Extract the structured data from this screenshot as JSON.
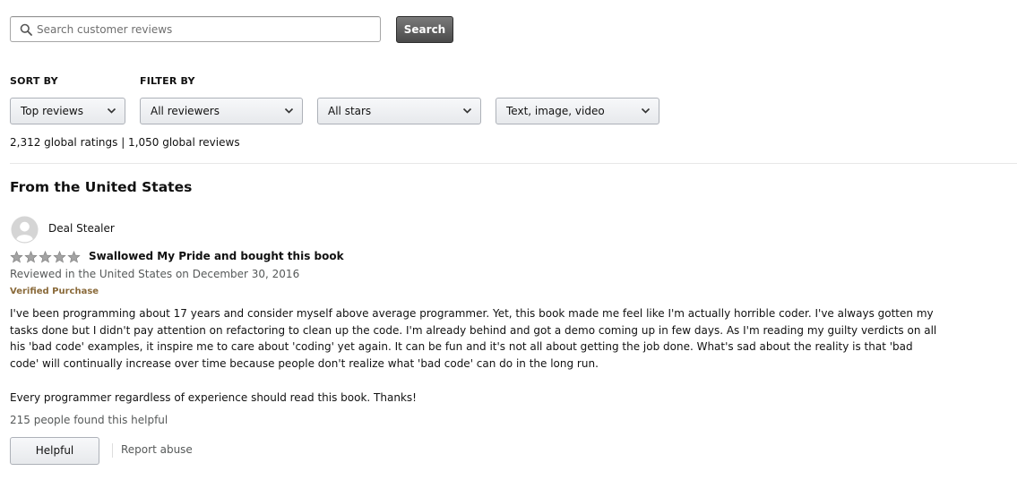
{
  "search": {
    "placeholder": "Search customer reviews",
    "button_label": "Search"
  },
  "sort": {
    "label": "SORT BY",
    "selected": "Top reviews"
  },
  "filter": {
    "label": "FILTER BY",
    "reviewers_selected": "All reviewers",
    "stars_selected": "All stars",
    "format_selected": "Text, image, video"
  },
  "summary": {
    "ratings_text": "2,312 global ratings | 1,050 global reviews"
  },
  "section": {
    "title": "From the United States"
  },
  "review": {
    "reviewer_name": "Deal Stealer",
    "star_rating": 5,
    "title": "Swallowed My Pride and bought this book",
    "date_line": "Reviewed in the United States on December 30, 2016",
    "verified": "Verified Purchase",
    "body_paragraph_1": "I've been programming about 17 years and consider myself above average programmer. Yet, this book made me feel like I'm actually horrible coder. I've always gotten my tasks done but I didn't pay attention on refactoring to clean up the code. I'm already behind and got a demo coming up in few days. As I'm reading my guilty verdicts on all his 'bad code' examples, it inspire me to care about 'coding' yet again. It can be fun and it's not all about getting the job done. What's sad about the reality is that 'bad code' will continually increase over time because people don't realize what 'bad code' can do in the long run.",
    "body_paragraph_2": "Every programmer regardless of experience should read this book. Thanks!",
    "helpful_count_text": "215 people found this helpful",
    "helpful_button_label": "Helpful",
    "report_label": "Report abuse"
  },
  "icons": {
    "search": "search-icon",
    "chevron": "chevron-down-icon",
    "avatar": "avatar-icon",
    "star": "star-icon"
  },
  "colors": {
    "search_button_bg": "#4a4a4a",
    "star_fill": "#9e9e9e",
    "verified_text": "#8a6a3a",
    "secondary_text": "#565959"
  }
}
